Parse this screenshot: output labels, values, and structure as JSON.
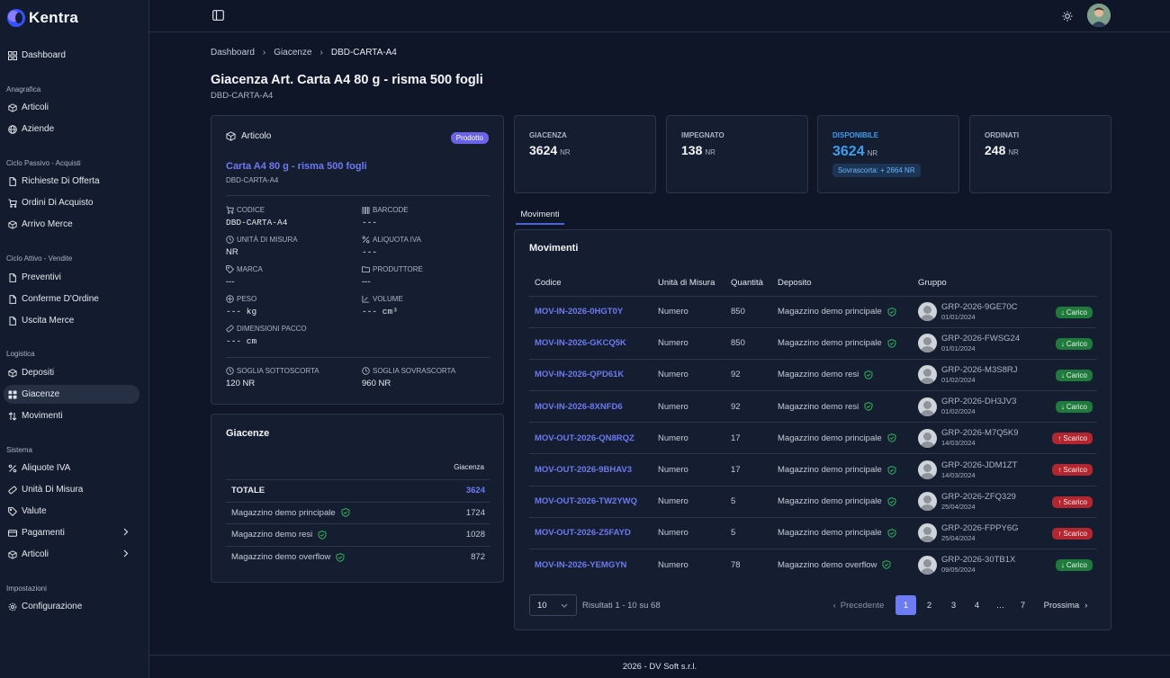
{
  "app": {
    "name": "Kentra"
  },
  "sidebar": {
    "items": [
      {
        "label": "Dashboard",
        "icon": "dashboard-icon"
      },
      {
        "label": "Articoli",
        "icon": "box-icon"
      },
      {
        "label": "Aziende",
        "icon": "globe-icon"
      },
      {
        "label": "Richieste Di Offerta",
        "icon": "file-icon"
      },
      {
        "label": "Ordini Di Acquisto",
        "icon": "cart-icon"
      },
      {
        "label": "Arrivo Merce",
        "icon": "box-icon"
      },
      {
        "label": "Preventivi",
        "icon": "file-icon"
      },
      {
        "label": "Conferme D'Ordine",
        "icon": "file-icon"
      },
      {
        "label": "Uscita Merce",
        "icon": "file-icon"
      },
      {
        "label": "Depositi",
        "icon": "box-icon"
      },
      {
        "label": "Giacenze",
        "icon": "grid-icon"
      },
      {
        "label": "Movimenti",
        "icon": "arrows-icon"
      },
      {
        "label": "Aliquote IVA",
        "icon": "percent-icon"
      },
      {
        "label": "Unità Di Misura",
        "icon": "ruler-icon"
      },
      {
        "label": "Valute",
        "icon": "tag-icon"
      },
      {
        "label": "Pagamenti",
        "icon": "card-icon"
      },
      {
        "label": "Articoli",
        "icon": "box-icon"
      },
      {
        "label": "Configurazione",
        "icon": "gear-icon"
      }
    ],
    "sections": [
      "Anagrafica",
      "Ciclo Passivo - Acquisti",
      "Ciclo Attivo - Vendite",
      "Logistica",
      "Sistema",
      "Impostazioni"
    ]
  },
  "breadcrumb": [
    "Dashboard",
    "Giacenze",
    "DBD-CARTA-A4"
  ],
  "page": {
    "title": "Giacenza Art. Carta A4 80 g - risma 500 fogli",
    "subtitle": "DBD-CARTA-A4"
  },
  "article": {
    "header": "Articolo",
    "badge": "Prodotto",
    "name": "Carta A4 80 g - risma 500 fogli",
    "code": "DBD-CARTA-A4",
    "fields": [
      {
        "label": "CODICE",
        "value": "DBD-CARTA-A4"
      },
      {
        "label": "BARCODE",
        "value": "---"
      },
      {
        "label": "UNITÀ DI MISURA",
        "value": "NR"
      },
      {
        "label": "ALIQUOTA IVA",
        "value": "---"
      },
      {
        "label": "MARCA",
        "value": "---"
      },
      {
        "label": "PRODUTTORE",
        "value": "---"
      },
      {
        "label": "PESO",
        "value": "--- kg"
      },
      {
        "label": "VOLUME",
        "value": "--- cm³"
      },
      {
        "label": "DIMENSIONI PACCO",
        "value": "--- cm"
      }
    ],
    "thresholds": [
      {
        "label": "SOGLIA SOTTOSCORTA",
        "value": "120 NR"
      },
      {
        "label": "SOGLIA SOVRASCORTA",
        "value": "960 NR"
      }
    ]
  },
  "kpis": [
    {
      "label": "GIACENZA",
      "value": "3624",
      "unit": "NR"
    },
    {
      "label": "IMPEGNATO",
      "value": "138",
      "unit": "NR"
    },
    {
      "label": "DISPONIBILE",
      "value": "3624",
      "unit": "NR",
      "note": "Sovrascorta: + 2664 NR"
    },
    {
      "label": "ORDINATI",
      "value": "248",
      "unit": "NR"
    }
  ],
  "tabs": [
    "Movimenti"
  ],
  "giacenze": {
    "title": "Giacenze",
    "column": "Giacenza",
    "total_label": "TOTALE",
    "total_value": "3624",
    "rows": [
      {
        "name": "Magazzino demo principale",
        "value": "1724"
      },
      {
        "name": "Magazzino demo resi",
        "value": "1028"
      },
      {
        "name": "Magazzino demo overflow",
        "value": "872"
      }
    ]
  },
  "movimenti": {
    "title": "Movimenti",
    "columns": [
      "Codice",
      "Unità di Misura",
      "Quantità",
      "Deposito",
      "Gruppo"
    ],
    "rows": [
      {
        "code": "MOV-IN-2026-0HGT0Y",
        "unit": "Numero",
        "qty": "850",
        "depot": "Magazzino demo principale",
        "group": "GRP-2026-9GE70C",
        "date": "01/01/2024",
        "type": "Carico"
      },
      {
        "code": "MOV-IN-2026-GKCQ5K",
        "unit": "Numero",
        "qty": "850",
        "depot": "Magazzino demo principale",
        "group": "GRP-2026-FWSG24",
        "date": "01/01/2024",
        "type": "Carico"
      },
      {
        "code": "MOV-IN-2026-QPD61K",
        "unit": "Numero",
        "qty": "92",
        "depot": "Magazzino demo resi",
        "group": "GRP-2026-M3S8RJ",
        "date": "01/02/2024",
        "type": "Carico"
      },
      {
        "code": "MOV-IN-2026-8XNFD6",
        "unit": "Numero",
        "qty": "92",
        "depot": "Magazzino demo resi",
        "group": "GRP-2026-DH3JV3",
        "date": "01/02/2024",
        "type": "Carico"
      },
      {
        "code": "MOV-OUT-2026-QN8RQZ",
        "unit": "Numero",
        "qty": "17",
        "depot": "Magazzino demo principale",
        "group": "GRP-2026-M7Q5K9",
        "date": "14/03/2024",
        "type": "Scarico"
      },
      {
        "code": "MOV-OUT-2026-9BHAV3",
        "unit": "Numero",
        "qty": "17",
        "depot": "Magazzino demo principale",
        "group": "GRP-2026-JDM1ZT",
        "date": "14/03/2024",
        "type": "Scarico"
      },
      {
        "code": "MOV-OUT-2026-TW2YWQ",
        "unit": "Numero",
        "qty": "5",
        "depot": "Magazzino demo principale",
        "group": "GRP-2026-ZFQ329",
        "date": "25/04/2024",
        "type": "Scarico"
      },
      {
        "code": "MOV-OUT-2026-Z5FAYD",
        "unit": "Numero",
        "qty": "5",
        "depot": "Magazzino demo principale",
        "group": "GRP-2026-FPPY6G",
        "date": "25/04/2024",
        "type": "Scarico"
      },
      {
        "code": "MOV-IN-2026-YEMGYN",
        "unit": "Numero",
        "qty": "78",
        "depot": "Magazzino demo overflow",
        "group": "GRP-2026-30TB1X",
        "date": "09/05/2024",
        "type": "Carico"
      }
    ]
  },
  "pagination": {
    "page_size": "10",
    "results": "Risultati 1 - 10 su 68",
    "prev": "Precedente",
    "next": "Prossima",
    "pages": [
      "1",
      "2",
      "3",
      "4",
      "…",
      "7"
    ]
  },
  "footer": "2026 - DV Soft s.r.l.",
  "colors": {
    "accent": "#6d79f0",
    "badge_prodotto": "#6b63e6",
    "carico": "#1f7a3c",
    "scarico": "#b3262f",
    "disponibile": "#3b9ff0"
  }
}
